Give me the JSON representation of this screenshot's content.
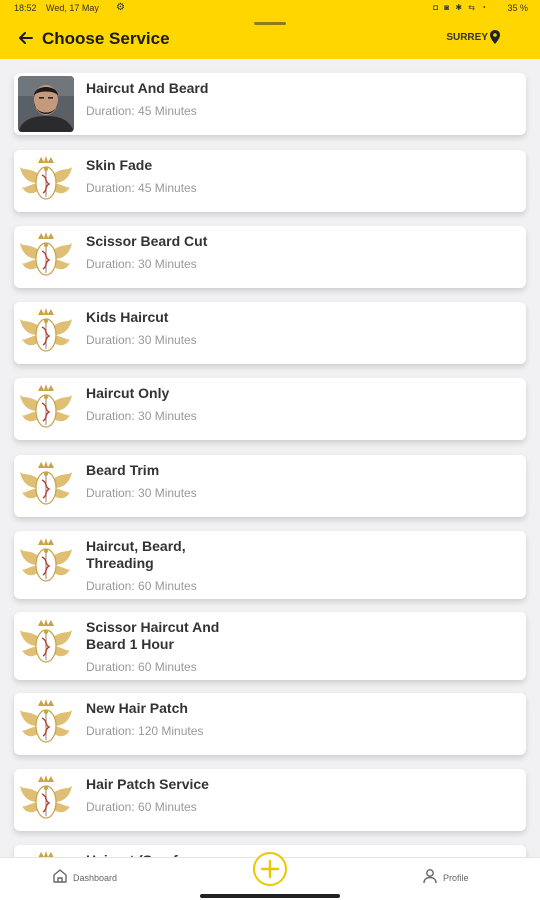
{
  "status_bar": {
    "time": "18:52",
    "date": "Wed, 17 May",
    "icons": "◘ ◙ ✱ ⇆ ◔",
    "battery": "35 %"
  },
  "header": {
    "title": "Choose Service",
    "location": "SURREY",
    "accent": "#FFD600"
  },
  "services": [
    {
      "name": "Haircut And Beard",
      "duration": "Duration: 45 Minutes",
      "thumb": "portrait"
    },
    {
      "name": "Skin Fade",
      "duration": "Duration: 45 Minutes",
      "thumb": "logo"
    },
    {
      "name": "Scissor Beard Cut",
      "duration": "Duration: 30 Minutes",
      "thumb": "logo"
    },
    {
      "name": "Kids Haircut",
      "duration": "Duration: 30 Minutes",
      "thumb": "logo"
    },
    {
      "name": "Haircut Only",
      "duration": "Duration: 30 Minutes",
      "thumb": "logo"
    },
    {
      "name": "Beard Trim",
      "duration": "Duration: 30 Minutes",
      "thumb": "logo"
    },
    {
      "name": "Haircut, Beard, Threading",
      "duration": "Duration: 60 Minutes",
      "thumb": "logo"
    },
    {
      "name": "Scissor Haircut And Beard 1 Hour",
      "duration": "Duration: 60 Minutes",
      "thumb": "logo"
    },
    {
      "name": "New Hair Patch",
      "duration": "Duration: 120 Minutes",
      "thumb": "logo"
    },
    {
      "name": "Hair Patch Service",
      "duration": "Duration: 60 Minutes",
      "thumb": "logo"
    },
    {
      "name": "Haircut (Scarf",
      "duration": "",
      "thumb": "logo"
    }
  ],
  "bottom_nav": {
    "dashboard": "Dashboard",
    "profile": "Profile"
  }
}
